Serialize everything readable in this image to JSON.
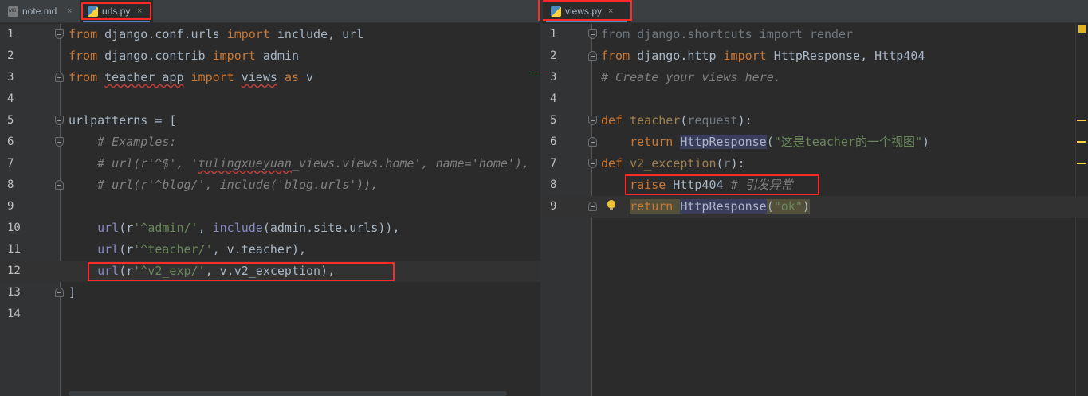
{
  "tabs_left": [
    {
      "label": "note.md",
      "icon": "markdown-file-icon",
      "active": false
    },
    {
      "label": "urls.py",
      "icon": "python-file-icon",
      "active": true
    }
  ],
  "tabs_right": [
    {
      "label": "views.py",
      "icon": "python-file-icon",
      "active": true
    }
  ],
  "close_glyph": "×",
  "urls": {
    "line_numbers": [
      "1",
      "2",
      "3",
      "4",
      "5",
      "6",
      "7",
      "8",
      "9",
      "10",
      "11",
      "12",
      "13",
      "14"
    ],
    "l1": {
      "a": "from",
      "b": " django.conf.urls ",
      "c": "import",
      "d": " include, url"
    },
    "l2": {
      "a": "from",
      "b": " django.contrib ",
      "c": "import",
      "d": " admin"
    },
    "l3": {
      "a": "from",
      "b1": " ",
      "b": "teacher_app",
      "b2": " ",
      "c": "import",
      "d1": " ",
      "d": "views",
      "e1": " ",
      "e": "as",
      "f": " v"
    },
    "l5": {
      "a": "urlpatterns = ["
    },
    "l6": {
      "a": "    # Examples:"
    },
    "l7": {
      "a": "    # url(r'^$', '",
      "b": "tulingxueyuan",
      "c": "_views.views.home', name='home'),"
    },
    "l8": {
      "a": "    # url(r'^blog/', include('blog.urls')),"
    },
    "l10": {
      "a": "    ",
      "b": "url",
      "c": "(r",
      "d": "'^admin/'",
      "e": ", ",
      "f": "include",
      "g": "(admin.site.urls)),"
    },
    "l11": {
      "a": "    ",
      "b": "url",
      "c": "(r",
      "d": "'^teacher/'",
      "e": ", v.teacher),"
    },
    "l12": {
      "a": "    ",
      "b": "url",
      "c": "(r",
      "d": "'^v2_exp/'",
      "e": ", v.v2_exception),"
    },
    "l13": {
      "a": "]"
    }
  },
  "views": {
    "line_numbers": [
      "1",
      "2",
      "3",
      "4",
      "5",
      "6",
      "7",
      "8",
      "9"
    ],
    "l1": {
      "a": "from django.shortcuts import render"
    },
    "l2": {
      "a": "from",
      "b": " django.http ",
      "c": "import",
      "d": " HttpResponse, Http404"
    },
    "l3": {
      "a": "# Create your views here."
    },
    "l5": {
      "a": "def",
      "b": " ",
      "c": "teacher",
      "d": "(",
      "e": "request",
      "f": "):"
    },
    "l6": {
      "a": "    ",
      "b": "return",
      "c": " ",
      "d": "HttpResponse",
      "e": "(",
      "f": "\"这是teacher的一个视图\"",
      "g": ")"
    },
    "l7": {
      "a": "def",
      "b": " ",
      "c": "v2_exception",
      "d": "(",
      "e": "r",
      "f": "):"
    },
    "l8": {
      "a": "    ",
      "b": "raise",
      "c": " Http404 ",
      "d": "# 引发异常"
    },
    "l9": {
      "a": "    ",
      "b": "return",
      "c": " ",
      "d": "HttpResponse",
      "e": "(",
      "f": "\"ok\"",
      "g": ")"
    }
  },
  "colors": {
    "background": "#2b2b2b",
    "keyword": "#cc7832",
    "comment": "#808080",
    "string": "#6a8759",
    "builtin": "#8888c6",
    "function": "#ffc66d",
    "annotation_box": "#ff2a2a"
  }
}
